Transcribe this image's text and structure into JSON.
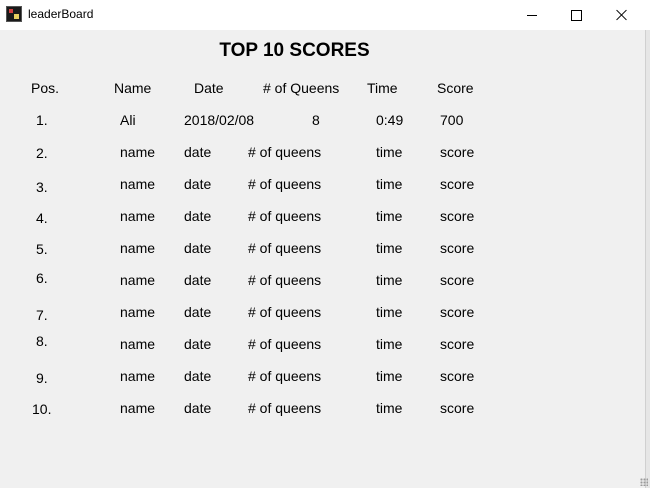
{
  "window": {
    "title": "leaderBoard"
  },
  "heading": "TOP 10 SCORES",
  "columns": {
    "pos": "Pos.",
    "name": "Name",
    "date": "Date",
    "queens": "# of Queens",
    "time": "Time",
    "score": "Score"
  },
  "rows": [
    {
      "pos": "1.",
      "name": "Ali",
      "date": "2018/02/08",
      "queens": "8",
      "time": "0:49",
      "score": "700"
    },
    {
      "pos": "2.",
      "name": "name",
      "date": "date",
      "queens": "# of queens",
      "time": "time",
      "score": "score"
    },
    {
      "pos": "3.",
      "name": "name",
      "date": "date",
      "queens": "# of queens",
      "time": "time",
      "score": "score"
    },
    {
      "pos": "4.",
      "name": "name",
      "date": "date",
      "queens": "# of queens",
      "time": "time",
      "score": "score"
    },
    {
      "pos": "5.",
      "name": "name",
      "date": "date",
      "queens": "# of queens",
      "time": "time",
      "score": "score"
    },
    {
      "pos": "6.",
      "name": "name",
      "date": "date",
      "queens": "# of queens",
      "time": "time",
      "score": "score"
    },
    {
      "pos": "7.",
      "name": "name",
      "date": "date",
      "queens": "# of queens",
      "time": "time",
      "score": "score"
    },
    {
      "pos": "8.",
      "name": "name",
      "date": "date",
      "queens": "# of queens",
      "time": "time",
      "score": "score"
    },
    {
      "pos": "9.",
      "name": "name",
      "date": "date",
      "queens": "# of queens",
      "time": "time",
      "score": "score"
    },
    {
      "pos": "10.",
      "name": "name",
      "date": "date",
      "queens": "# of queens",
      "time": "time",
      "score": "score"
    }
  ],
  "colors": {
    "window_background": "#f0f0f0",
    "titlebar_background": "#ffffff",
    "text": "#000000"
  }
}
